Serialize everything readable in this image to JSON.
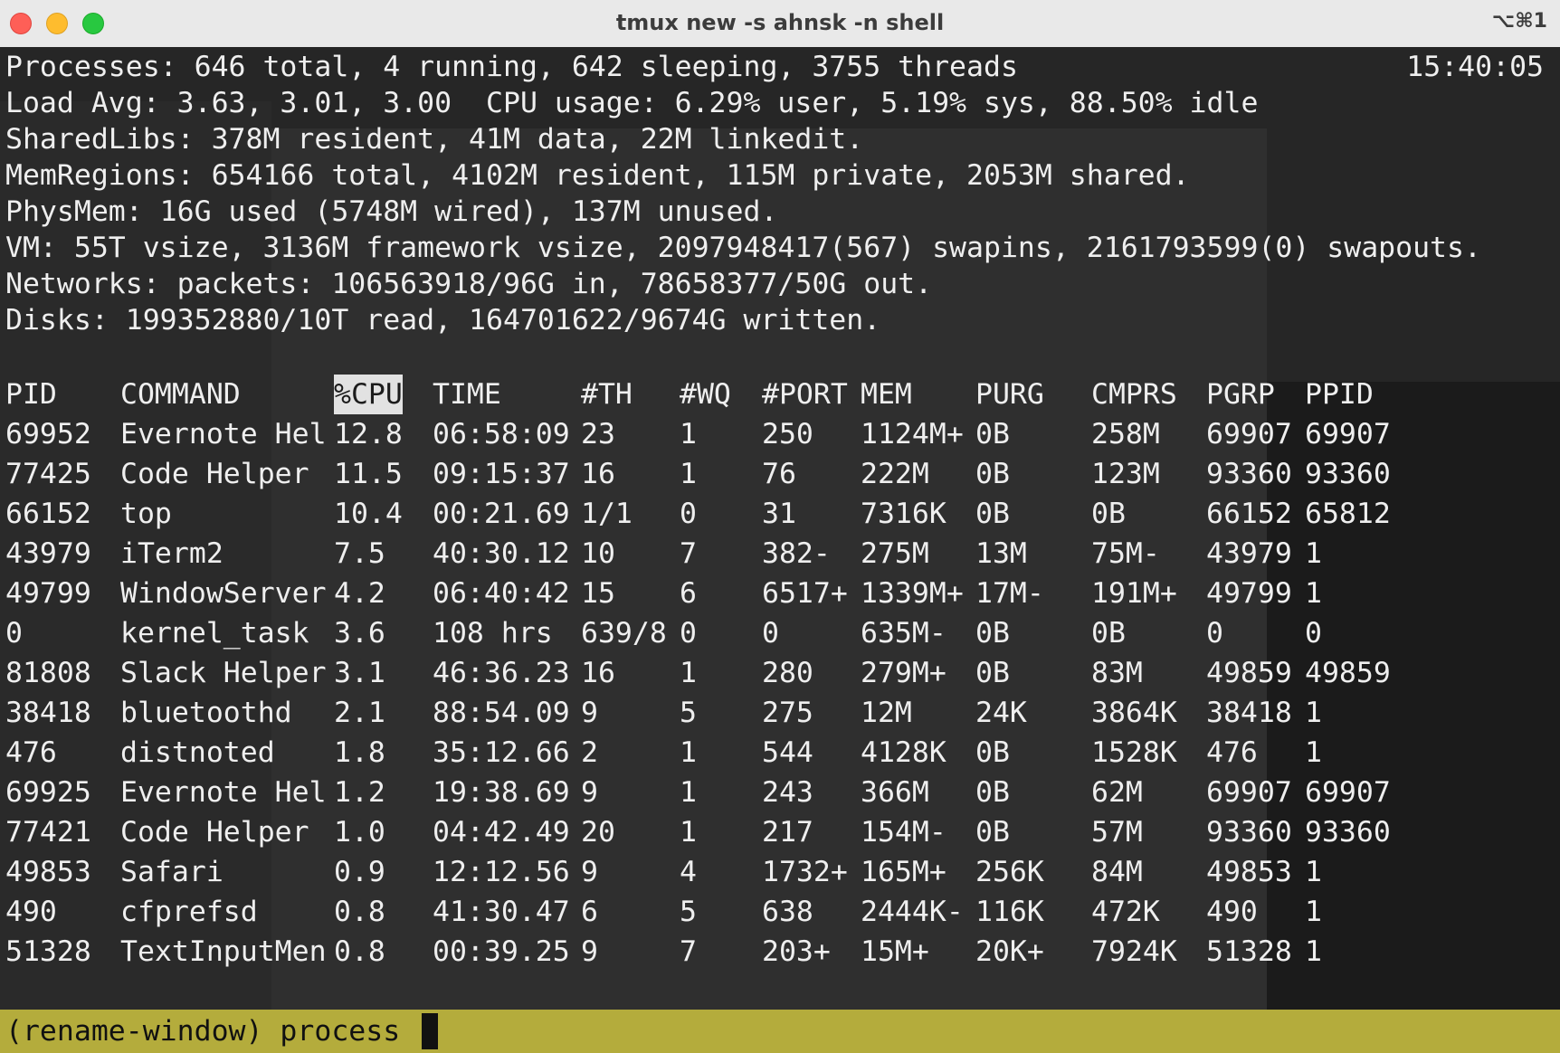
{
  "window": {
    "title": "tmux new -s ahnsk -n shell",
    "shortcut": "⌥⌘1"
  },
  "summary": {
    "clock": "15:40:05",
    "lines": [
      "Processes: 646 total, 4 running, 642 sleeping, 3755 threads",
      "Load Avg: 3.63, 3.01, 3.00  CPU usage: 6.29% user, 5.19% sys, 88.50% idle",
      "SharedLibs: 378M resident, 41M data, 22M linkedit.",
      "MemRegions: 654166 total, 4102M resident, 115M private, 2053M shared.",
      "PhysMem: 16G used (5748M wired), 137M unused.",
      "VM: 55T vsize, 3136M framework vsize, 2097948417(567) swapins, 2161793599(0) swapouts.",
      "Networks: packets: 106563918/96G in, 78658377/50G out.",
      "Disks: 199352880/10T read, 164701622/9674G written."
    ]
  },
  "table": {
    "columns": [
      "PID",
      "COMMAND",
      "%CPU",
      "TIME",
      "#TH",
      "#WQ",
      "#PORT",
      "MEM",
      "PURG",
      "CMPRS",
      "PGRP",
      "PPID"
    ],
    "rows": [
      [
        "69952",
        "Evernote Hel",
        "12.8",
        "06:58:09",
        "23",
        "1",
        "250",
        "1124M+",
        "0B",
        "258M",
        "69907",
        "69907"
      ],
      [
        "77425",
        "Code Helper",
        "11.5",
        "09:15:37",
        "16",
        "1",
        "76",
        "222M",
        "0B",
        "123M",
        "93360",
        "93360"
      ],
      [
        "66152",
        "top",
        "10.4",
        "00:21.69",
        "1/1",
        "0",
        "31",
        "7316K",
        "0B",
        "0B",
        "66152",
        "65812"
      ],
      [
        "43979",
        "iTerm2",
        "7.5",
        "40:30.12",
        "10",
        "7",
        "382-",
        "275M",
        "13M",
        "75M-",
        "43979",
        "1"
      ],
      [
        "49799",
        "WindowServer",
        "4.2",
        "06:40:42",
        "15",
        "6",
        "6517+",
        "1339M+",
        "17M-",
        "191M+",
        "49799",
        "1"
      ],
      [
        "0",
        "kernel_task",
        "3.6",
        "108 hrs",
        "639/8",
        "0",
        "0",
        "635M-",
        "0B",
        "0B",
        "0",
        "0"
      ],
      [
        "81808",
        "Slack Helper",
        "3.1",
        "46:36.23",
        "16",
        "1",
        "280",
        "279M+",
        "0B",
        "83M",
        "49859",
        "49859"
      ],
      [
        "38418",
        "bluetoothd",
        "2.1",
        "88:54.09",
        "9",
        "5",
        "275",
        "12M",
        "24K",
        "3864K",
        "38418",
        "1"
      ],
      [
        "476",
        "distnoted",
        "1.8",
        "35:12.66",
        "2",
        "1",
        "544",
        "4128K",
        "0B",
        "1528K",
        "476",
        "1"
      ],
      [
        "69925",
        "Evernote Hel",
        "1.2",
        "19:38.69",
        "9",
        "1",
        "243",
        "366M",
        "0B",
        "62M",
        "69907",
        "69907"
      ],
      [
        "77421",
        "Code Helper",
        "1.0",
        "04:42.49",
        "20",
        "1",
        "217",
        "154M-",
        "0B",
        "57M",
        "93360",
        "93360"
      ],
      [
        "49853",
        "Safari",
        "0.9",
        "12:12.56",
        "9",
        "4",
        "1732+",
        "165M+",
        "256K",
        "84M",
        "49853",
        "1"
      ],
      [
        "490",
        "cfprefsd",
        "0.8",
        "41:30.47",
        "6",
        "5",
        "638",
        "2444K-",
        "116K",
        "472K",
        "490",
        "1"
      ],
      [
        "51328",
        "TextInputMen",
        "0.8",
        "00:39.25",
        "9",
        "7",
        "203+",
        "15M+",
        "20K+",
        "7924K",
        "51328",
        "1"
      ]
    ]
  },
  "status": {
    "prompt": "(rename-window) process"
  }
}
